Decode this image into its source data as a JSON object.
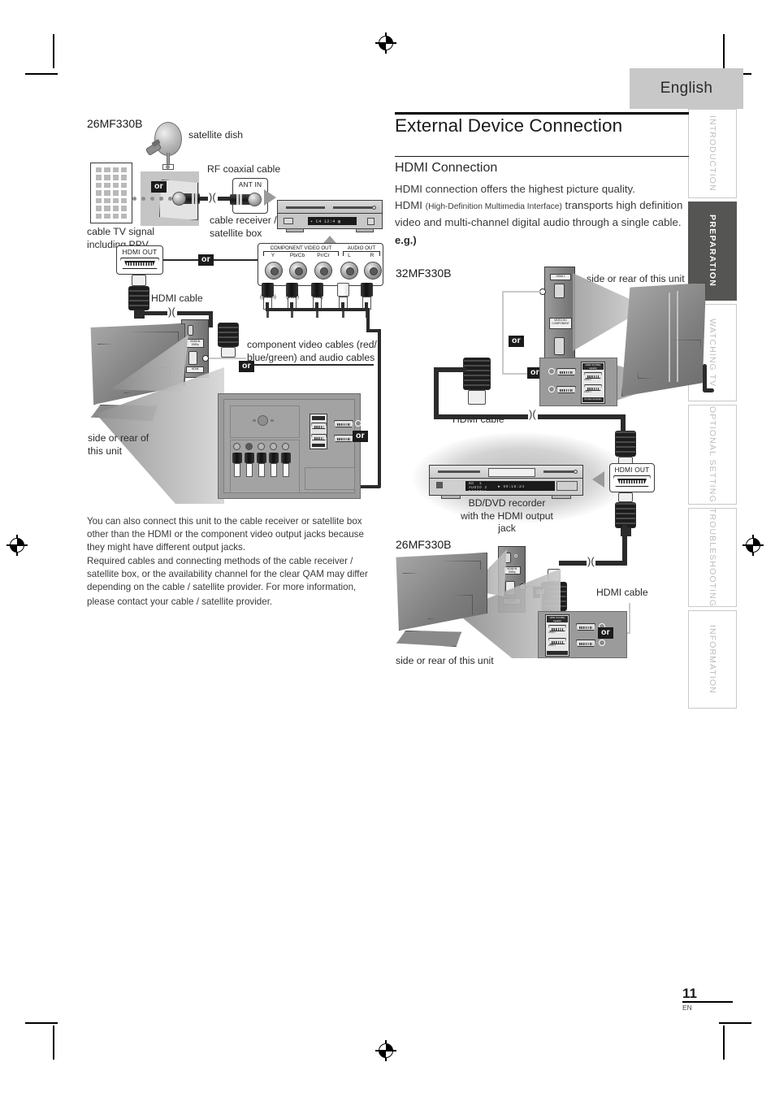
{
  "page": {
    "language_tab": "English",
    "number": "11",
    "number_suffix": "EN"
  },
  "side_tabs": [
    {
      "label": "INTRODUCTION",
      "active": false
    },
    {
      "label": "PREPARATION",
      "active": true
    },
    {
      "label": "WATCHING TV",
      "active": false
    },
    {
      "label": "OPTIONAL SETTING",
      "active": false
    },
    {
      "label": "TROUBLESHOOTING",
      "active": false
    },
    {
      "label": "INFORMATION",
      "active": false
    }
  ],
  "main": {
    "title": "External Device Connection",
    "section_title": "HDMI Connection",
    "body_line1": "HDMI connection offers the highest picture quality.",
    "body_line2_pre": "HDMI ",
    "body_line2_paren": "(High-Definition Multimedia Interface)",
    "body_line2_post": " transports high definition",
    "body_line3": "video and multi-channel digital audio through a single cable.",
    "eg": "e.g.)"
  },
  "diagram_left": {
    "model": "26MF330B",
    "satellite_dish": "satellite dish",
    "rf_cable": "RF coaxial cable",
    "ant_in": "ANT IN",
    "cable_receiver": "cable receiver /",
    "satellite_box": "satellite box",
    "cable_tv_signal": "cable TV signal",
    "including_ppv": "including PPV",
    "hdmi_out": "HDMI OUT",
    "hdmi_cable": "HDMI cable",
    "component_label_1": "component video cables (red/",
    "component_label_2": "blue/green) and audio cables",
    "side_or_rear_1": "side or rear of",
    "side_or_rear_2": "this unit",
    "or_badge": "or",
    "jack_panel": {
      "component_group": "COMPONENT VIDEO OUT",
      "audio_group": "AUDIO OUT",
      "jacks": [
        {
          "name": "Y",
          "color_note": "(green)"
        },
        {
          "name": "Pb/Cb",
          "color_note": "(blue)"
        },
        {
          "name": "Pr/Cr",
          "color_note": "(red)"
        },
        {
          "name": "L",
          "color_note": ""
        },
        {
          "name": "R",
          "color_note": ""
        }
      ]
    }
  },
  "note": {
    "p1": "You can also connect this unit to the cable receiver or satellite box other than the HDMI or the component video output jacks because they might have different output jacks.",
    "p2": "Required cables and connecting methods of the cable receiver / satellite box, or the availability channel for the clear QAM may differ depending on the cable / satellite provider. For more information,",
    "p3": "please contact your cable / satellite provider."
  },
  "diagram_32": {
    "model": "32MF330B",
    "side_or_rear": "side or rear of this unit",
    "hdmi_cable": "HDMI cable",
    "or_badge": "or",
    "panel_tag_top": "HDMI 1",
    "panel_tag_bottom": "VIDEO IN / COMPONENT",
    "jack_card_title": "HDMI IN (1080p capable)",
    "jack_card_label_1": "HDMI 2",
    "jack_card_label_2": "HDMI 1",
    "jack_card_footer": "No video connection"
  },
  "recorder": {
    "label_1": "BD/DVD recorder",
    "label_2": "with the HDMI output jack",
    "hdmi_out": "HDMI OUT",
    "display_text": "59:18:24"
  },
  "diagram_26": {
    "model": "26MF330B",
    "side_or_rear": "side or rear of this unit",
    "hdmi_cable": "HDMI cable",
    "or_badge": "or",
    "jack_card_title": "HDMI IN (1080p capable)",
    "jack_card_label_1": "HDMI 2",
    "jack_card_label_2": "HDMI 1"
  },
  "colors": {
    "accent_dark": "#555554",
    "lang_tab_bg": "#c8c8c8",
    "text": "#231f20",
    "tab_inactive_text": "#bdbdbd"
  }
}
